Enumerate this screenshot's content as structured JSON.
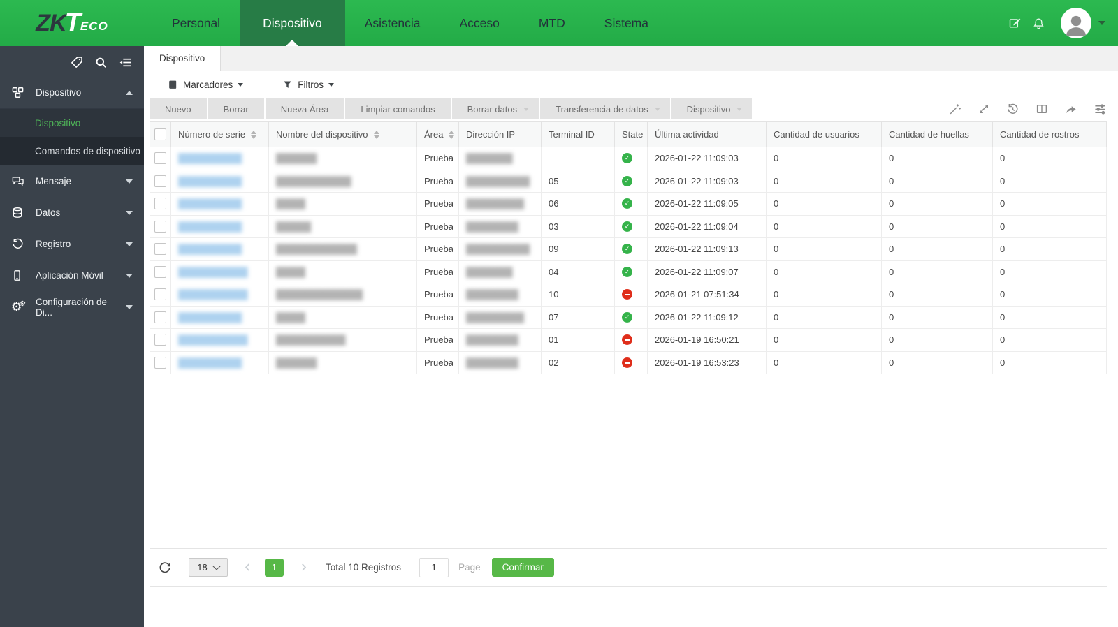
{
  "brand": {
    "zk": "ZK",
    "t": "T",
    "eco": "ECO"
  },
  "navbar": {
    "items": [
      {
        "label": "Personal",
        "active": false
      },
      {
        "label": "Dispositivo",
        "active": true
      },
      {
        "label": "Asistencia",
        "active": false
      },
      {
        "label": "Acceso",
        "active": false
      },
      {
        "label": "MTD",
        "active": false
      },
      {
        "label": "Sistema",
        "active": false
      }
    ]
  },
  "sidebar": {
    "sections": [
      {
        "label": "Dispositivo",
        "expanded": true,
        "children": [
          {
            "label": "Dispositivo",
            "active": true
          },
          {
            "label": "Comandos de dispositivo",
            "active": false
          }
        ]
      },
      {
        "label": "Mensaje",
        "expanded": false
      },
      {
        "label": "Datos",
        "expanded": false
      },
      {
        "label": "Registro",
        "expanded": false
      },
      {
        "label": "Aplicación Móvil",
        "expanded": false
      },
      {
        "label": "Configuración de Di...",
        "expanded": false
      }
    ]
  },
  "tabstrip": {
    "tabs": [
      {
        "label": "Dispositivo",
        "active": true
      }
    ]
  },
  "toolbar": {
    "bookmarks_label": "Marcadores",
    "filters_label": "Filtros"
  },
  "action_bar": {
    "buttons": [
      {
        "label": "Nuevo",
        "dropdown": false
      },
      {
        "label": "Borrar",
        "dropdown": false
      },
      {
        "label": "Nueva Área",
        "dropdown": false
      },
      {
        "label": "Limpiar comandos",
        "dropdown": false
      },
      {
        "label": "Borrar datos",
        "dropdown": true
      },
      {
        "label": "Transferencia de datos",
        "dropdown": true
      },
      {
        "label": "Dispositivo",
        "dropdown": true
      }
    ]
  },
  "table": {
    "columns": [
      "Número de serie",
      "Nombre del dispositivo",
      "Área",
      "Dirección IP",
      "Terminal ID",
      "State",
      "Última actividad",
      "Cantidad de usuarios",
      "Cantidad de huellas",
      "Cantidad de rostros"
    ],
    "rows": [
      {
        "serial": "███████████",
        "name": "███████",
        "area": "Prueba",
        "ip": "████████",
        "terminal": "",
        "state": "online",
        "last_activity": "2026-01-22 11:09:03",
        "users": "0",
        "fingerprints": "0",
        "faces": "0"
      },
      {
        "serial": "███████████",
        "name": "█████████████",
        "area": "Prueba",
        "ip": "███████████",
        "terminal": "05",
        "state": "online",
        "last_activity": "2026-01-22 11:09:03",
        "users": "0",
        "fingerprints": "0",
        "faces": "0"
      },
      {
        "serial": "███████████",
        "name": "█████",
        "area": "Prueba",
        "ip": "██████████",
        "terminal": "06",
        "state": "online",
        "last_activity": "2026-01-22 11:09:05",
        "users": "0",
        "fingerprints": "0",
        "faces": "0"
      },
      {
        "serial": "███████████",
        "name": "██████",
        "area": "Prueba",
        "ip": "█████████",
        "terminal": "03",
        "state": "online",
        "last_activity": "2026-01-22 11:09:04",
        "users": "0",
        "fingerprints": "0",
        "faces": "0"
      },
      {
        "serial": "███████████",
        "name": "██████████████",
        "area": "Prueba",
        "ip": "███████████",
        "terminal": "09",
        "state": "online",
        "last_activity": "2026-01-22 11:09:13",
        "users": "0",
        "fingerprints": "0",
        "faces": "0"
      },
      {
        "serial": "████████████",
        "name": "█████",
        "area": "Prueba",
        "ip": "████████",
        "terminal": "04",
        "state": "online",
        "last_activity": "2026-01-22 11:09:07",
        "users": "0",
        "fingerprints": "0",
        "faces": "0"
      },
      {
        "serial": "████████████",
        "name": "███████████████",
        "area": "Prueba",
        "ip": "█████████",
        "terminal": "10",
        "state": "offline",
        "last_activity": "2026-01-21 07:51:34",
        "users": "0",
        "fingerprints": "0",
        "faces": "0"
      },
      {
        "serial": "███████████",
        "name": "█████",
        "area": "Prueba",
        "ip": "██████████",
        "terminal": "07",
        "state": "online",
        "last_activity": "2026-01-22 11:09:12",
        "users": "0",
        "fingerprints": "0",
        "faces": "0"
      },
      {
        "serial": "████████████",
        "name": "████████████",
        "area": "Prueba",
        "ip": "█████████",
        "terminal": "01",
        "state": "offline",
        "last_activity": "2026-01-19 16:50:21",
        "users": "0",
        "fingerprints": "0",
        "faces": "0"
      },
      {
        "serial": "███████████",
        "name": "███████",
        "area": "Prueba",
        "ip": "█████████",
        "terminal": "02",
        "state": "offline",
        "last_activity": "2026-01-19 16:53:23",
        "users": "0",
        "fingerprints": "0",
        "faces": "0"
      }
    ]
  },
  "pagination": {
    "page_size": "18",
    "current_page": "1",
    "total_label": "Total 10 Registros",
    "page_input": "1",
    "page_label": "Page",
    "confirm_label": "Confirmar"
  },
  "icons": {
    "state_online": "check-circle-green",
    "state_offline": "minus-circle-red"
  },
  "colors": {
    "navbar_green": "#26b14a",
    "active_tab_green": "#277c46",
    "sidebar_dark": "#3a424b",
    "accent_green": "#57b847",
    "active_menu_text": "#4fb558",
    "state_ok": "#35b34a",
    "state_blocked": "#df2e1b"
  }
}
